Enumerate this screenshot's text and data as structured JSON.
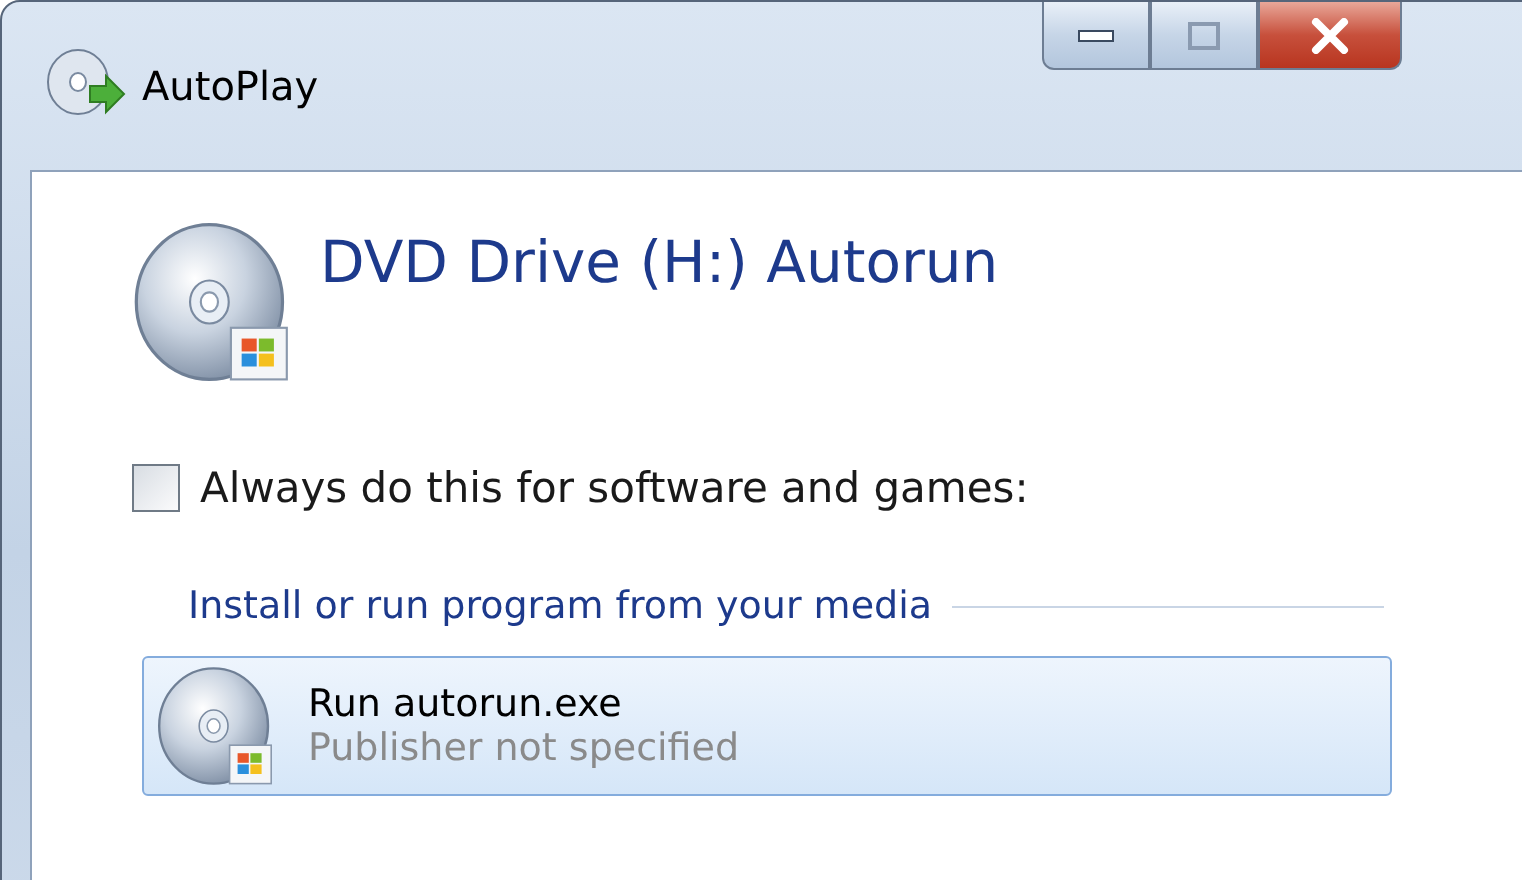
{
  "window": {
    "title": "AutoPlay"
  },
  "device": {
    "title": "DVD Drive (H:) Autorun"
  },
  "always_option": {
    "label": "Always do this for software and games:",
    "checked": false
  },
  "sections": [
    {
      "heading": "Install or run program from your media",
      "options": [
        {
          "title": "Run autorun.exe",
          "subtitle": "Publisher not specified",
          "selected": true
        }
      ]
    }
  ]
}
